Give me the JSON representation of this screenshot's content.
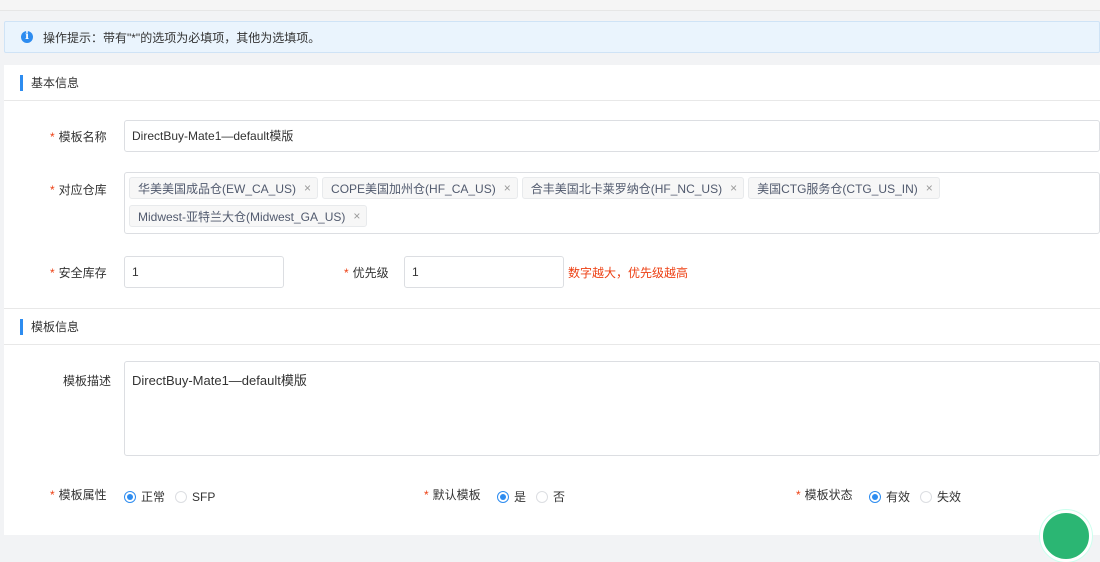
{
  "tip": {
    "text": "操作提示：带有\"*\"的选项为必填项，其他为选填项。"
  },
  "basic": {
    "title": "基本信息",
    "template_name": {
      "label": "模板名称",
      "value": "DirectBuy-Mate1—default模版"
    },
    "warehouse": {
      "label": "对应仓库",
      "tags": [
        "华美美国成品仓(EW_CA_US)",
        "COPE美国加州仓(HF_CA_US)",
        "合丰美国北卡莱罗纳仓(HF_NC_US)",
        "美国CTG服务仓(CTG_US_IN)",
        "Midwest-亚特兰大仓(Midwest_GA_US)"
      ],
      "remove_icon": "×"
    },
    "safety_stock": {
      "label": "安全库存",
      "value": "1"
    },
    "priority": {
      "label": "优先级",
      "value": "1",
      "hint": "数字越大，优先级越高"
    }
  },
  "template": {
    "title": "模板信息",
    "description": {
      "label": "模板描述",
      "value": "DirectBuy-Mate1—default模版"
    },
    "attribute": {
      "label": "模板属性",
      "options": [
        "正常",
        "SFP"
      ],
      "selected": 0
    },
    "default": {
      "label": "默认模板",
      "options": [
        "是",
        "否"
      ],
      "selected": 0
    },
    "status": {
      "label": "模板状态",
      "options": [
        "有效",
        "失效"
      ],
      "selected": 0
    }
  },
  "required_mark": "*",
  "colors": {
    "accent": "#2d8cf0",
    "required": "#ed4014",
    "tip_bg": "#eaf4fd"
  }
}
